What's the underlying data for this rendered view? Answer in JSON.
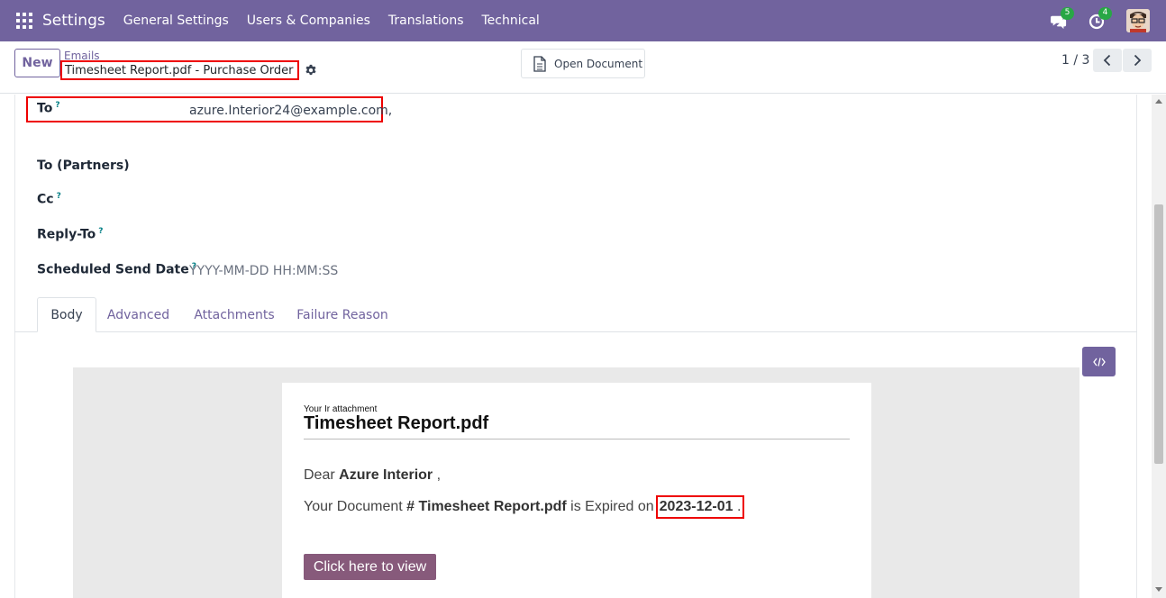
{
  "navbar": {
    "app_name": "Settings",
    "menu": [
      "General Settings",
      "Users & Companies",
      "Translations",
      "Technical"
    ],
    "messages_count": "5",
    "activities_count": "4",
    "color": "#71639e"
  },
  "control": {
    "new_label": "New",
    "breadcrumb": "Emails",
    "record_name": "Timesheet Report.pdf - Purchase Order",
    "open_document_label": "Open Document",
    "pager": "1 / 3"
  },
  "fields": {
    "to": {
      "label": "To",
      "help": "?",
      "value": "azure.Interior24@example.com,"
    },
    "to_partners": {
      "label": "To (Partners)"
    },
    "cc": {
      "label": "Cc",
      "help": "?"
    },
    "reply_to": {
      "label": "Reply-To",
      "help": "?"
    },
    "scheduled": {
      "label": "Scheduled Send Date",
      "help": "?",
      "placeholder": "YYYY-MM-DD HH:MM:SS"
    }
  },
  "tabs": [
    "Body",
    "Advanced",
    "Attachments",
    "Failure Reason"
  ],
  "active_tab": "Body",
  "mail": {
    "small_header": "Your Ir attachment",
    "title": "Timesheet Report.pdf",
    "greeting_prefix": "Dear",
    "customer": "Azure Interior",
    "greeting_suffix": ",",
    "doc_prefix": "Your Document",
    "hash": "#",
    "doc_name": "Timesheet Report.pdf",
    "expired_text": "is Expired on",
    "expiry_date": "2023-12-01",
    "period": ".",
    "button_label": "Click here to view",
    "button_color": "#875a7b"
  }
}
